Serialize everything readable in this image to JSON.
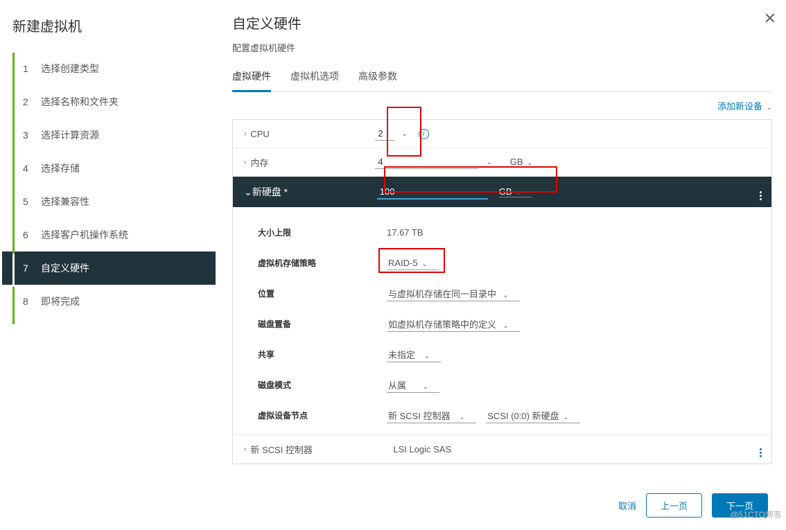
{
  "wizard": {
    "title": "新建虚拟机",
    "steps": [
      {
        "num": "1",
        "label": "选择创建类型"
      },
      {
        "num": "2",
        "label": "选择名称和文件夹"
      },
      {
        "num": "3",
        "label": "选择计算资源"
      },
      {
        "num": "4",
        "label": "选择存储"
      },
      {
        "num": "5",
        "label": "选择兼容性"
      },
      {
        "num": "6",
        "label": "选择客户机操作系统"
      },
      {
        "num": "7",
        "label": "自定义硬件"
      },
      {
        "num": "8",
        "label": "即将完成"
      }
    ]
  },
  "page": {
    "title": "自定义硬件",
    "subtitle": "配置虚拟机硬件",
    "tabs": {
      "hw": "虚拟硬件",
      "opts": "虚拟机选项",
      "adv": "高级参数"
    },
    "add_device": "添加新设备"
  },
  "cpu": {
    "label": "CPU",
    "value": "2"
  },
  "mem": {
    "label": "内存",
    "value": "4",
    "unit": "GB"
  },
  "disk": {
    "label": "新硬盘 *",
    "size": "100",
    "unit": "GB",
    "max_label": "大小上限",
    "max_value": "17.67 TB",
    "policy_label": "虚拟机存储策略",
    "policy_value": "RAID-5",
    "location_label": "位置",
    "location_value": "与虚拟机存储在同一目录中",
    "provision_label": "磁盘置备",
    "provision_value": "如虚拟机存储策略中的定义",
    "share_label": "共享",
    "share_value": "未指定",
    "mode_label": "磁盘模式",
    "mode_value": "从属",
    "node_label": "虚拟设备节点",
    "node_ctrl": "新 SCSI 控制器",
    "node_addr": "SCSI (0:0) 新硬盘"
  },
  "scsi": {
    "label": "新 SCSI 控制器",
    "value": "LSI Logic SAS"
  },
  "footer": {
    "cancel": "取消",
    "prev": "上一页",
    "next": "下一页"
  },
  "watermark": "@51CTO博客"
}
